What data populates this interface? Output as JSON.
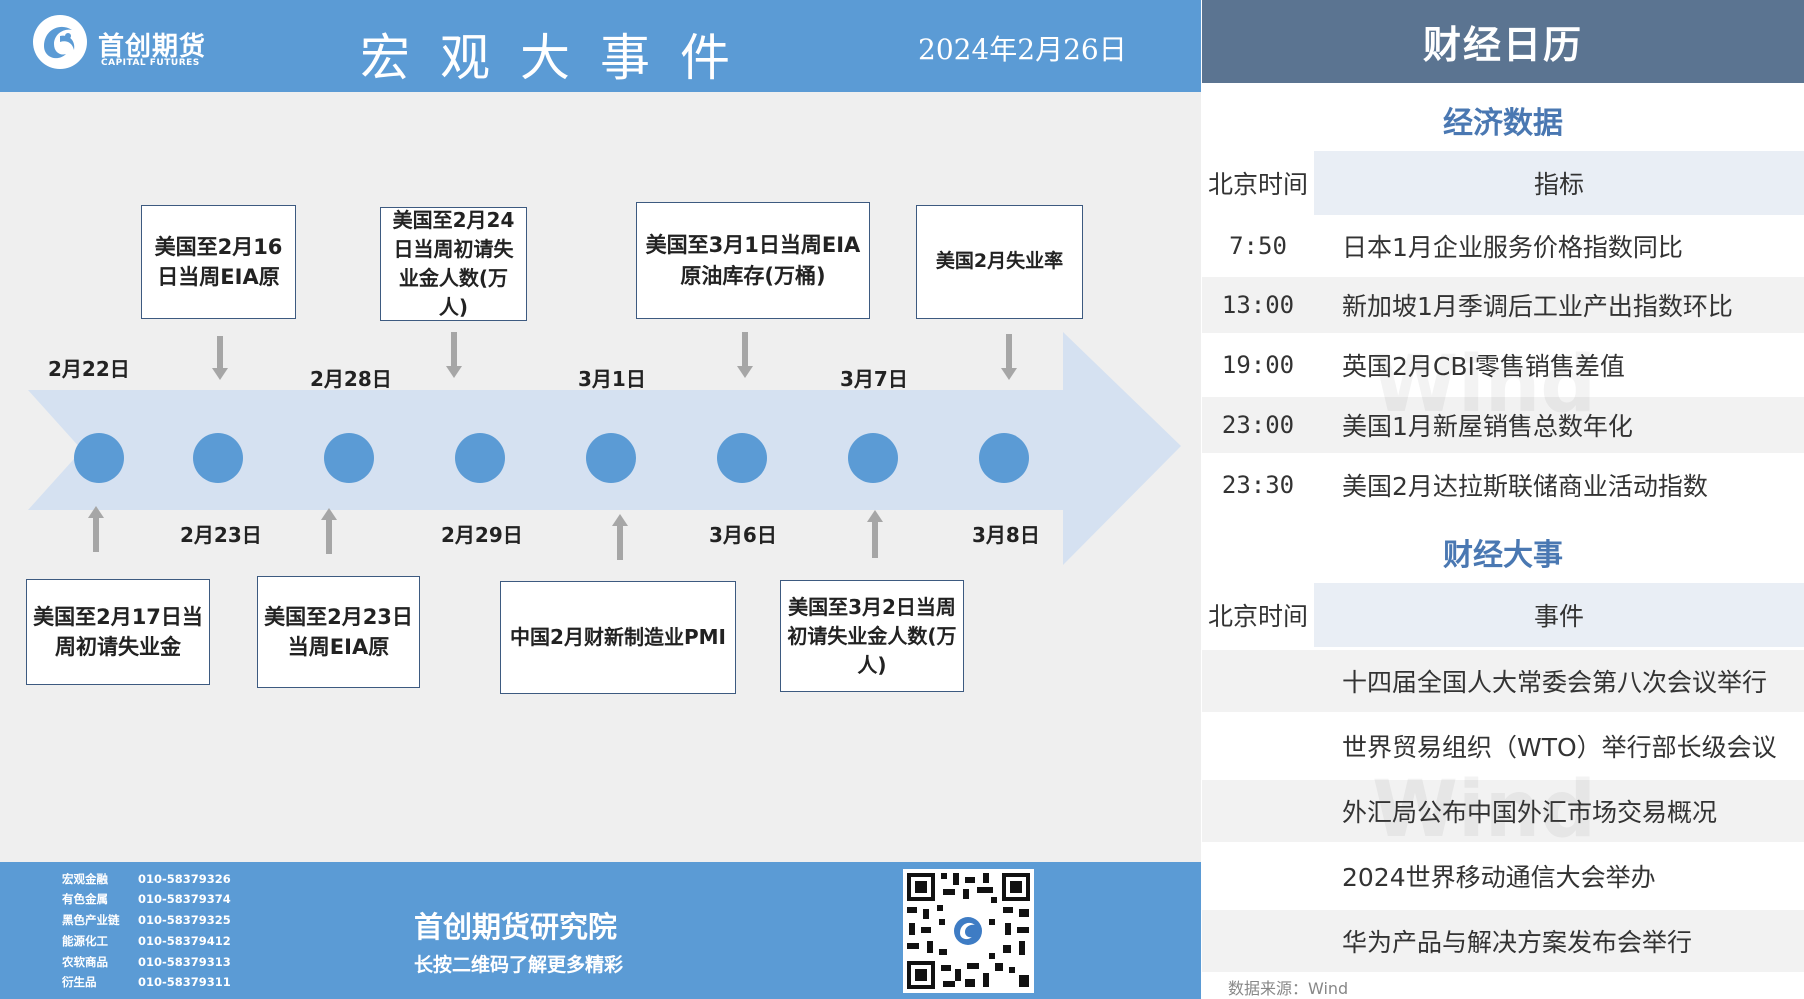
{
  "header": {
    "brand_cn": "首创期货",
    "brand_en": "CAPITAL FUTURES",
    "title": "宏观大事件",
    "date": "2024年2月26日"
  },
  "timeline": {
    "dates_top": [
      "2月22日",
      "2月28日",
      "3月1日",
      "3月7日"
    ],
    "dates_bottom": [
      "2月23日",
      "2月29日",
      "3月6日",
      "3月8日"
    ],
    "events_top": [
      "美国至2月16日当周EIA原",
      "美国至2月24日当周初请失业金人数(万人)",
      "美国至3月1日当周EIA原油库存(万桶)",
      "美国2月失业率"
    ],
    "events_bottom": [
      "美国至2月17日当周初请失业金",
      "美国至2月23日当周EIA原",
      "中国2月财新制造业PMI",
      "美国至3月2日当周初请失业金人数(万人)"
    ]
  },
  "footer": {
    "contacts": [
      {
        "dept": "宏观金融",
        "phone": "010-58379326"
      },
      {
        "dept": "有色金属",
        "phone": "010-58379374"
      },
      {
        "dept": "黑色产业链",
        "phone": "010-58379325"
      },
      {
        "dept": "能源化工",
        "phone": "010-58379412"
      },
      {
        "dept": "农软商品",
        "phone": "010-58379313"
      },
      {
        "dept": "衍生品",
        "phone": "010-58379311"
      }
    ],
    "institute": "首创期货研究院",
    "slogan": "长按二维码了解更多精彩"
  },
  "calendar": {
    "title": "财经日历",
    "econ": {
      "section": "经济数据",
      "col_time": "北京时间",
      "col_item": "指标",
      "rows": [
        {
          "time": "7:50",
          "item": "日本1月企业服务价格指数同比"
        },
        {
          "time": "13:00",
          "item": "新加坡1月季调后工业产出指数环比"
        },
        {
          "time": "19:00",
          "item": "英国2月CBI零售销售差值"
        },
        {
          "time": "23:00",
          "item": "美国1月新屋销售总数年化"
        },
        {
          "time": "23:30",
          "item": "美国2月达拉斯联储商业活动指数"
        }
      ]
    },
    "events": {
      "section": "财经大事",
      "col_time": "北京时间",
      "col_item": "事件",
      "rows": [
        {
          "time": "",
          "item": "十四届全国人大常委会第八次会议举行"
        },
        {
          "time": "",
          "item": "世界贸易组织（WTO）举行部长级会议"
        },
        {
          "time": "",
          "item": "外汇局公布中国外汇市场交易概况"
        },
        {
          "time": "",
          "item": "2024世界移动通信大会举办"
        },
        {
          "time": "",
          "item": "华为产品与解决方案发布会举行"
        }
      ]
    },
    "watermark": "Wind",
    "source": "数据来源：Wind"
  },
  "colors": {
    "header_blue": "#5b9bd5",
    "calendar_header": "#5b7491",
    "section_blue": "#4a78b2",
    "arrow_fill": "#d5e1f1",
    "node_blue": "#5b9bd5"
  },
  "icons": [
    "logo-icon",
    "down-arrow-icon",
    "up-arrow-icon",
    "qr-code"
  ]
}
